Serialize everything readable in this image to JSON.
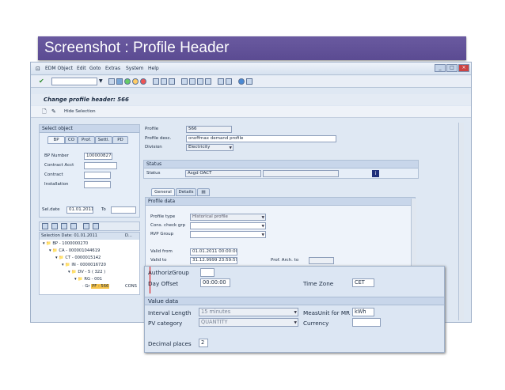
{
  "banner": {
    "title": "Screenshot : Profile Header"
  },
  "menu": [
    "EDM Object",
    "Edit",
    "Goto",
    "Extras",
    "System",
    "Help"
  ],
  "screen_title": "Change profile header: 566",
  "app_toolbar": {
    "hide_selection": "Hide Selection"
  },
  "select_object": {
    "title": "Select object",
    "tabs": [
      "BP",
      "CO",
      "Prof.",
      "Settl.",
      "PD"
    ],
    "fields": [
      {
        "label": "BP Number",
        "value": "1000008270"
      },
      {
        "label": "Contract Acct",
        "value": ""
      },
      {
        "label": "Contract",
        "value": ""
      },
      {
        "label": "Installation",
        "value": ""
      }
    ],
    "sel_date_label": "Sel.date",
    "sel_date": "01.01.2011",
    "to_label": "To",
    "to_value": ""
  },
  "tree": {
    "header": "Selection Date: 01.01.2011",
    "col2": "D...",
    "nodes": [
      "BP - 1000000270",
      "CA - 000001044619",
      "CT - 0000015142",
      "IN - 0000016720",
      "DV - 5 ( 322 )",
      "RG - 001",
      "PF - 566"
    ],
    "last_prefix": "Gr",
    "last_suffix": "CONS"
  },
  "profile": {
    "profile_label": "Profile",
    "profile_value": "566",
    "desc_label": "Profile desc.",
    "desc_value": "onoffmax demand profile",
    "division_label": "Division",
    "division_value": "Electricity"
  },
  "status": {
    "title": "Status",
    "label": "Status",
    "value": "Asgd OACT"
  },
  "detail_tabs": [
    "General",
    "Details"
  ],
  "profile_data": {
    "title": "Profile data",
    "type_label": "Profile type",
    "type_value": "Historical profile",
    "cons_label": "Cons. check grp",
    "rvp_label": "RVP Group",
    "from_label": "Valid from",
    "from_value": "01.01.2011 00:00:00",
    "to_label": "Valid to",
    "to_value": "31.12.9999 23:59:59",
    "arch_label": "Prof. Arch. to"
  },
  "zoom": {
    "auth_label": "AuthorizGroup",
    "offset_label": "Day Offset",
    "offset_value": "00:00:00",
    "tz_label": "Time Zone",
    "tz_value": "CET",
    "value_title": "Value data",
    "interval_label": "Interval Length",
    "interval_value": "15 minutes",
    "meas_label": "MeasUnit for MR",
    "meas_value": "kWh",
    "pv_label": "PV category",
    "pv_value": "QUANTITY",
    "currency_label": "Currency",
    "currency_value": "",
    "decimal_label": "Decimal places",
    "decimal_value": "2"
  },
  "colors": {
    "banner": "#5b4b92",
    "sap_bg": "#dfe8f3",
    "header_bar": "#c8d6ea",
    "status_icon": "#1f2f7a"
  }
}
